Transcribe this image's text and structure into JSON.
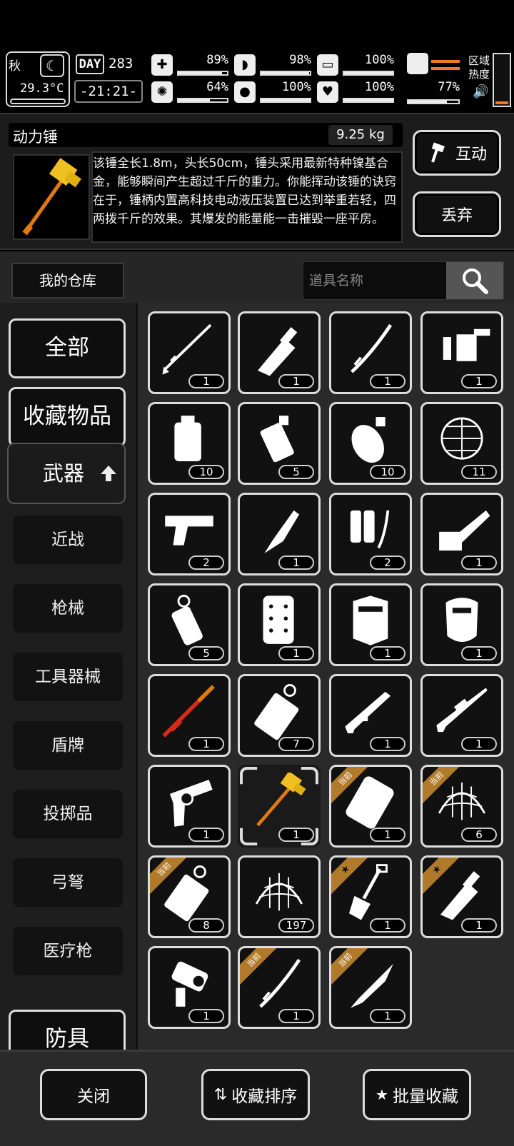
{
  "status": {
    "season": "秋",
    "temperature": "29.3°C",
    "day_label": "DAY",
    "day": "283",
    "time": "-21:21-",
    "stats": [
      {
        "icon": "medkit-icon",
        "glyph": "✚",
        "value": "89%",
        "level": 0.89
      },
      {
        "icon": "stomach-icon",
        "glyph": "◗",
        "value": "98%",
        "level": 0.98
      },
      {
        "icon": "energy-icon",
        "glyph": "▭",
        "value": "100%",
        "level": 1.0
      },
      {
        "icon": "brain-icon",
        "glyph": "✺",
        "value": "64%",
        "level": 0.64
      },
      {
        "icon": "water-drop-icon",
        "glyph": "●",
        "value": "100%",
        "level": 1.0
      },
      {
        "icon": "heart-icon",
        "glyph": "♥",
        "value": "100%",
        "level": 1.0
      }
    ],
    "stamina_value": "77%",
    "stamina_level": 0.77,
    "region_heat_label": "区域\n热度"
  },
  "item": {
    "name": "动力锤",
    "weight": "9.25 kg",
    "description": "该锤全长1.8m，头长50cm，锤头采用最新特种镍基合金，能够瞬间产生超过千斤的重力。你能挥动该锤的诀窍在于，锤柄内置高科技电动液压装置已达到举重若轻，四两拨千斤的效果。其爆发的能量能一击摧毁一座平房。",
    "interact_label": "互动",
    "drop_label": "丢弃"
  },
  "warehouse": {
    "title": "我的仓库",
    "search_placeholder": "道具名称"
  },
  "categories": {
    "all": "全部",
    "favorites": "收藏物品",
    "weapons": "武器",
    "subs": [
      "近战",
      "枪械",
      "工具器械",
      "盾牌",
      "投掷品",
      "弓弩",
      "医疗枪"
    ],
    "armor": "防具"
  },
  "items": [
    {
      "icon": "spear-icon",
      "qty": "1"
    },
    {
      "icon": "cleaver-icon",
      "qty": "1"
    },
    {
      "icon": "katana-icon",
      "qty": "1"
    },
    {
      "icon": "flamethrower-icon",
      "qty": "1"
    },
    {
      "icon": "incendiary-grenade-icon",
      "qty": "10"
    },
    {
      "icon": "stun-grenade-icon",
      "qty": "5"
    },
    {
      "icon": "frag-grenade-icon",
      "qty": "10"
    },
    {
      "icon": "net-bomb-icon",
      "qty": "11"
    },
    {
      "icon": "pistol-icon",
      "qty": "2"
    },
    {
      "icon": "combat-knife-icon",
      "qty": "1"
    },
    {
      "icon": "fire-extinguisher-pack-icon",
      "qty": "2"
    },
    {
      "icon": "chainsaw-icon",
      "qty": "1"
    },
    {
      "icon": "smoke-grenade-icon",
      "qty": "5"
    },
    {
      "icon": "riot-shield-icon",
      "qty": "1"
    },
    {
      "icon": "tactical-shield-icon",
      "qty": "1"
    },
    {
      "icon": "police-shield-icon",
      "qty": "1"
    },
    {
      "icon": "rifle-icon",
      "qty": "1"
    },
    {
      "icon": "canister-icon",
      "qty": "7"
    },
    {
      "icon": "assault-rifle-icon",
      "qty": "1"
    },
    {
      "icon": "sniper-rifle-icon",
      "qty": "1"
    },
    {
      "icon": "revolver-icon",
      "qty": "1"
    },
    {
      "icon": "power-hammer-icon",
      "qty": "1"
    },
    {
      "icon": "shield-icon",
      "qty": "1",
      "badge": "当前"
    },
    {
      "icon": "net-icon",
      "qty": "6",
      "badge": "当前"
    },
    {
      "icon": "canister-icon",
      "qty": "8",
      "badge": "当前"
    },
    {
      "icon": "net-icon",
      "qty": "197"
    },
    {
      "icon": "shovel-icon",
      "qty": "1",
      "badge": "★"
    },
    {
      "icon": "cleaver-icon",
      "qty": "1",
      "badge": "★"
    },
    {
      "icon": "blaster-icon",
      "qty": "1"
    },
    {
      "icon": "katana-icon",
      "qty": "1",
      "badge": "当前"
    },
    {
      "icon": "knife-icon",
      "qty": "1",
      "badge": "当前"
    }
  ],
  "bottom": {
    "close": "关闭",
    "sort": "收藏排序",
    "batch": "批量收藏"
  }
}
